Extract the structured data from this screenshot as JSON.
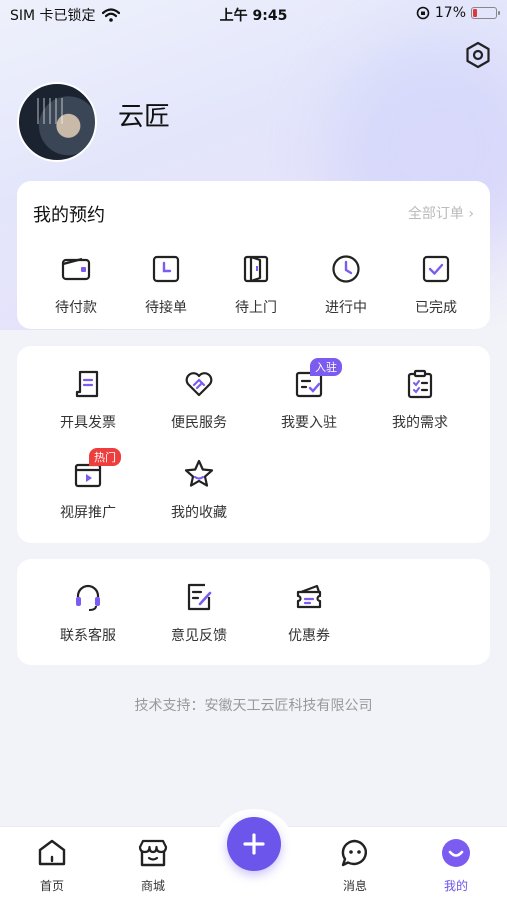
{
  "status_bar": {
    "carrier": "SIM 卡已锁定",
    "time": "上午 9:45",
    "battery": "17%",
    "battery_level": 0.17
  },
  "profile": {
    "name": "云匠"
  },
  "appointments": {
    "title": "我的预约",
    "more": "全部订单 ›",
    "items": [
      {
        "label": "待付款",
        "icon": "wallet-icon"
      },
      {
        "label": "待接单",
        "icon": "clock-frame-icon"
      },
      {
        "label": "待上门",
        "icon": "door-icon"
      },
      {
        "label": "进行中",
        "icon": "clock-icon"
      },
      {
        "label": "已完成",
        "icon": "check-box-icon"
      }
    ]
  },
  "services": {
    "items": [
      {
        "label": "开具发票",
        "icon": "invoice-icon"
      },
      {
        "label": "便民服务",
        "icon": "handshake-heart-icon"
      },
      {
        "label": "我要入驻",
        "icon": "register-icon",
        "badge": "入驻"
      },
      {
        "label": "我的需求",
        "icon": "clipboard-icon"
      },
      {
        "label": "视屏推广",
        "icon": "video-icon",
        "badge": "热门"
      },
      {
        "label": "我的收藏",
        "icon": "star-icon"
      }
    ],
    "badge_colors": {
      "入驻": "#7c5cf0",
      "热门": "#ee3d3d"
    }
  },
  "support": {
    "items": [
      {
        "label": "联系客服",
        "icon": "headset-icon"
      },
      {
        "label": "意见反馈",
        "icon": "feedback-icon"
      },
      {
        "label": "优惠券",
        "icon": "coupon-icon"
      }
    ]
  },
  "footer": {
    "text": "技术支持：安徽天工云匠科技有限公司"
  },
  "tabbar": {
    "tabs": [
      {
        "label": "首页",
        "icon": "home-icon"
      },
      {
        "label": "商城",
        "icon": "store-icon"
      },
      {
        "label": "消息",
        "icon": "message-icon"
      },
      {
        "label": "我的",
        "icon": "profile-face-icon",
        "active": true
      }
    ],
    "fab_icon": "plus-icon"
  },
  "colors": {
    "accent": "#6b55ea",
    "icon_stroke": "#222222",
    "icon_accent": "#7c5cf0"
  }
}
